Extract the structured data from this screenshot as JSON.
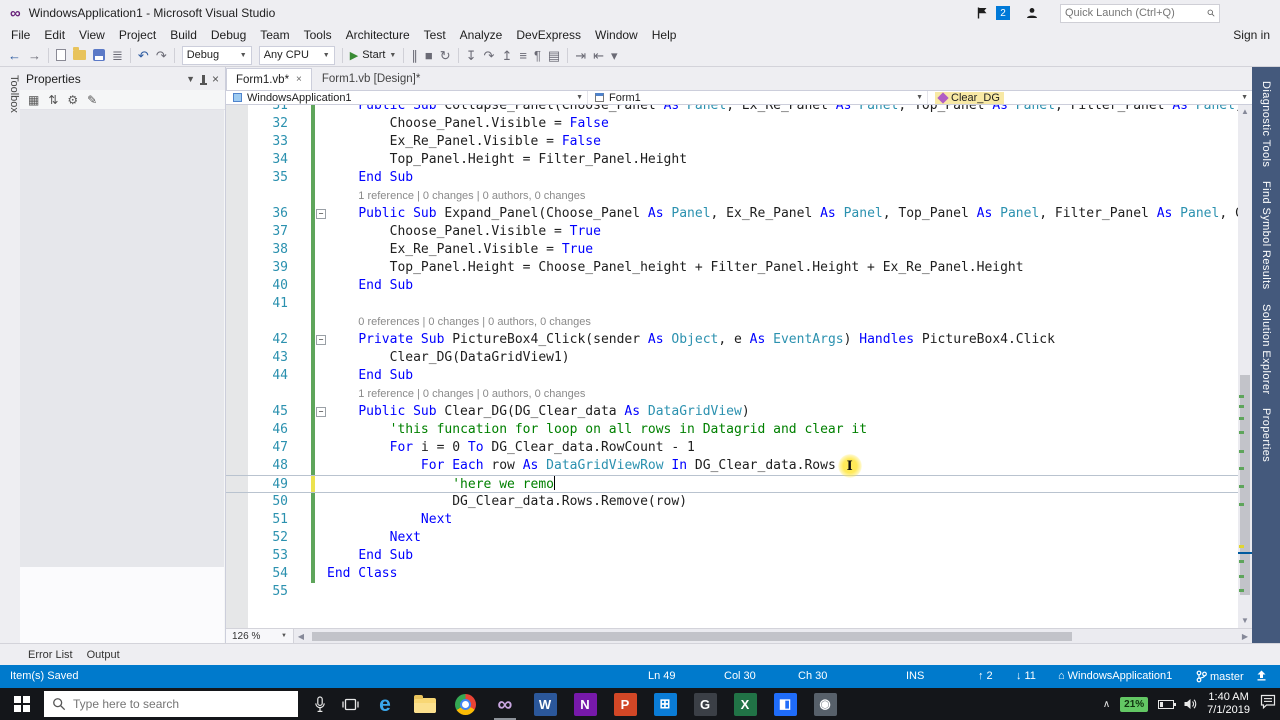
{
  "colors": {
    "accent": "#007acc",
    "statusbar": "#007acc",
    "keyword": "#0000ff",
    "type": "#2b91af",
    "comment": "#008000",
    "line_number": "#2b91af",
    "change_saved": "#5ea55b",
    "change_unsaved": "#ece24e",
    "member_highlight": "#f8e9a5",
    "taskbar": "#14161a"
  },
  "title_bar": {
    "app_title": "WindowsApplication1 - Microsoft Visual Studio",
    "notification_count": "2",
    "quick_launch_placeholder": "Quick Launch (Ctrl+Q)"
  },
  "menu_bar": {
    "items": [
      "File",
      "Edit",
      "View",
      "Project",
      "Build",
      "Debug",
      "Team",
      "Tools",
      "Architecture",
      "Test",
      "Analyze",
      "DevExpress",
      "Window",
      "Help"
    ],
    "sign_in_label": "Sign in"
  },
  "toolbar": {
    "config_dropdown": "Debug",
    "platform_dropdown": "Any CPU",
    "start_label": "Start"
  },
  "icons": {
    "back_arrow": "←",
    "forward_arrow": "→",
    "undo_arrow": "↶",
    "redo_arrow": "↷",
    "start_triangle": "▶",
    "dropdown_arrow": "▼",
    "pause": "∥",
    "stop": "■",
    "refresh": "↻",
    "close": "×",
    "scroll_up": "▲",
    "scroll_down": "▼",
    "scroll_left": "◀",
    "scroll_right": "▶",
    "chevron_up": "∧"
  },
  "left_dock": {
    "toolbox_tab": "Toolbox"
  },
  "properties_panel": {
    "title": "Properties"
  },
  "bottom_tabs": {
    "error_list": "Error List",
    "output": "Output"
  },
  "document_tabs": [
    {
      "label": "Form1.vb*",
      "active": true
    },
    {
      "label": "Form1.vb [Design]*",
      "active": false
    }
  ],
  "navigation_bar": {
    "project": "WindowsApplication1",
    "type": "Form1",
    "member": "Clear_DG"
  },
  "editor": {
    "zoom": "126 %",
    "rows": [
      {
        "n": "31",
        "indent": 4,
        "bar": "g",
        "tokens": [
          [
            "kw",
            "Public Sub "
          ],
          [
            "pl",
            "Collapse_Panel(Choose_Panel "
          ],
          [
            "kw",
            "As "
          ],
          [
            "ty",
            "Panel"
          ],
          [
            "pl",
            ", Ex_Re_Panel "
          ],
          [
            "kw",
            "As "
          ],
          [
            "ty",
            "Panel"
          ],
          [
            "pl",
            ", Top_Panel "
          ],
          [
            "kw",
            "As "
          ],
          [
            "ty",
            "Panel"
          ],
          [
            "pl",
            ", Filter_Panel "
          ],
          [
            "kw",
            "As "
          ],
          [
            "ty",
            "Panel"
          ],
          [
            "pl",
            ")"
          ]
        ]
      },
      {
        "n": "32",
        "indent": 8,
        "bar": "g",
        "tokens": [
          [
            "pl",
            "Choose_Panel.Visible = "
          ],
          [
            "kw",
            "False"
          ]
        ]
      },
      {
        "n": "33",
        "indent": 8,
        "bar": "g",
        "tokens": [
          [
            "pl",
            "Ex_Re_Panel.Visible = "
          ],
          [
            "kw",
            "False"
          ]
        ]
      },
      {
        "n": "34",
        "indent": 8,
        "bar": "g",
        "tokens": [
          [
            "pl",
            "Top_Panel.Height = Filter_Panel.Height"
          ]
        ]
      },
      {
        "n": "35",
        "indent": 4,
        "bar": "g",
        "tokens": [
          [
            "kw",
            "End Sub"
          ]
        ]
      },
      {
        "lens": "1 reference | 0 changes | 0 authors, 0 changes",
        "indent": 4,
        "bar": "g"
      },
      {
        "n": "36",
        "indent": 4,
        "fold": true,
        "bar": "g",
        "tokens": [
          [
            "kw",
            "Public Sub "
          ],
          [
            "pl",
            "Expand_Panel(Choose_Panel "
          ],
          [
            "kw",
            "As "
          ],
          [
            "ty",
            "Panel"
          ],
          [
            "pl",
            ", Ex_Re_Panel "
          ],
          [
            "kw",
            "As "
          ],
          [
            "ty",
            "Panel"
          ],
          [
            "pl",
            ", Top_Panel "
          ],
          [
            "kw",
            "As "
          ],
          [
            "ty",
            "Panel"
          ],
          [
            "pl",
            ", Filter_Panel "
          ],
          [
            "kw",
            "As "
          ],
          [
            "ty",
            "Panel"
          ],
          [
            "pl",
            ", Choose"
          ]
        ]
      },
      {
        "n": "37",
        "indent": 8,
        "bar": "g",
        "tokens": [
          [
            "pl",
            "Choose_Panel.Visible = "
          ],
          [
            "kw",
            "True"
          ]
        ]
      },
      {
        "n": "38",
        "indent": 8,
        "bar": "g",
        "tokens": [
          [
            "pl",
            "Ex_Re_Panel.Visible = "
          ],
          [
            "kw",
            "True"
          ]
        ]
      },
      {
        "n": "39",
        "indent": 8,
        "bar": "g",
        "tokens": [
          [
            "pl",
            "Top_Panel.Height = Choose_Panel_height + Filter_Panel.Height + Ex_Re_Panel.Height"
          ]
        ]
      },
      {
        "n": "40",
        "indent": 4,
        "bar": "g",
        "tokens": [
          [
            "kw",
            "End Sub"
          ]
        ]
      },
      {
        "n": "41",
        "indent": 0,
        "bar": "g",
        "tokens": []
      },
      {
        "lens": "0 references | 0 changes | 0 authors, 0 changes",
        "indent": 4,
        "bar": "g"
      },
      {
        "n": "42",
        "indent": 4,
        "fold": true,
        "bar": "g",
        "tokens": [
          [
            "kw",
            "Private Sub "
          ],
          [
            "pl",
            "PictureBox4_Click(sender "
          ],
          [
            "kw",
            "As "
          ],
          [
            "ty",
            "Object"
          ],
          [
            "pl",
            ", e "
          ],
          [
            "kw",
            "As "
          ],
          [
            "ty",
            "EventArgs"
          ],
          [
            "pl",
            ") "
          ],
          [
            "kw",
            "Handles "
          ],
          [
            "pl",
            "PictureBox4.Click"
          ]
        ]
      },
      {
        "n": "43",
        "indent": 8,
        "bar": "g",
        "tokens": [
          [
            "pl",
            "Clear_DG(DataGridView1)"
          ]
        ]
      },
      {
        "n": "44",
        "indent": 4,
        "bar": "g",
        "tokens": [
          [
            "kw",
            "End Sub"
          ]
        ]
      },
      {
        "lens": "1 reference | 0 changes | 0 authors, 0 changes",
        "indent": 4,
        "bar": "g"
      },
      {
        "n": "45",
        "indent": 4,
        "fold": true,
        "bar": "g",
        "tokens": [
          [
            "kw",
            "Public Sub "
          ],
          [
            "pl",
            "Clear_DG(DG_Clear_data "
          ],
          [
            "kw",
            "As "
          ],
          [
            "ty",
            "DataGridView"
          ],
          [
            "pl",
            ")"
          ]
        ]
      },
      {
        "n": "46",
        "indent": 8,
        "bar": "g",
        "tokens": [
          [
            "cm",
            "'this funcation for loop on all rows in Datagrid and clear it"
          ]
        ]
      },
      {
        "n": "47",
        "indent": 8,
        "bar": "g",
        "tokens": [
          [
            "kw",
            "For "
          ],
          [
            "pl",
            "i = 0 "
          ],
          [
            "kw",
            "To "
          ],
          [
            "pl",
            "DG_Clear_data.RowCount - 1"
          ]
        ]
      },
      {
        "n": "48",
        "indent": 12,
        "bar": "g",
        "cursor": true,
        "tokens": [
          [
            "kw",
            "For Each "
          ],
          [
            "pl",
            "row "
          ],
          [
            "kw",
            "As "
          ],
          [
            "ty",
            "DataGridViewRow"
          ],
          [
            "pl",
            " "
          ],
          [
            "kw",
            "In "
          ],
          [
            "pl",
            "DG_Clear_data.Rows"
          ]
        ]
      },
      {
        "n": "49",
        "indent": 16,
        "bar": "y",
        "current": true,
        "caret": true,
        "tokens": [
          [
            "cm",
            "'here we remo"
          ]
        ]
      },
      {
        "n": "50",
        "indent": 16,
        "bar": "g",
        "tokens": [
          [
            "pl",
            "DG_Clear_data.Rows.Remove(row)"
          ]
        ]
      },
      {
        "n": "51",
        "indent": 12,
        "bar": "g",
        "tokens": [
          [
            "kw",
            "Next"
          ]
        ]
      },
      {
        "n": "52",
        "indent": 8,
        "bar": "g",
        "tokens": [
          [
            "kw",
            "Next"
          ]
        ]
      },
      {
        "n": "53",
        "indent": 4,
        "bar": "g",
        "tokens": [
          [
            "kw",
            "End Sub"
          ]
        ]
      },
      {
        "n": "54",
        "indent": 0,
        "bar": "g",
        "tokens": [
          [
            "kw",
            "End Class"
          ]
        ]
      },
      {
        "n": "55",
        "indent": 0,
        "tokens": []
      }
    ]
  },
  "right_dock": {
    "tabs": [
      "Diagnostic Tools",
      "Find Symbol Results",
      "Solution Explorer",
      "Properties"
    ]
  },
  "status_bar": {
    "message": "Item(s) Saved",
    "line": "Ln 49",
    "column": "Col 30",
    "character": "Ch 30",
    "mode": "INS",
    "commits_ahead": "2",
    "commits_behind": "11",
    "repository": "WindowsApplication1",
    "branch": "master"
  },
  "taskbar": {
    "search_placeholder": "Type here to search",
    "apps": [
      {
        "name": "microsoft-edge",
        "kind": "glyph",
        "glyph": "e",
        "color": "#3aa7eb"
      },
      {
        "name": "file-explorer",
        "kind": "folder"
      },
      {
        "name": "google-chrome",
        "kind": "chrome"
      },
      {
        "name": "visual-studio",
        "kind": "glyph",
        "glyph": "∞",
        "color": "#c9a6e0",
        "open": true
      },
      {
        "name": "microsoft-word",
        "kind": "tile",
        "glyph": "W",
        "color": "#2b579a"
      },
      {
        "name": "onenote",
        "kind": "tile",
        "glyph": "N",
        "color": "#7719aa"
      },
      {
        "name": "powerpoint",
        "kind": "tile",
        "glyph": "P",
        "color": "#d24726"
      },
      {
        "name": "microsoft-store",
        "kind": "tile",
        "glyph": "⊞",
        "color": "#0a7cd6"
      },
      {
        "name": "github-desktop",
        "kind": "tile",
        "glyph": "G",
        "color": "#3b3f46"
      },
      {
        "name": "excel",
        "kind": "tile",
        "glyph": "X",
        "color": "#217346"
      },
      {
        "name": "photos",
        "kind": "tile",
        "glyph": "◧",
        "color": "#1f6cf9"
      },
      {
        "name": "camera",
        "kind": "tile",
        "glyph": "◉",
        "color": "#57606a"
      }
    ],
    "tray": {
      "battery_percent": "21%",
      "time": "1:40 AM",
      "date": "7/1/2019"
    }
  }
}
